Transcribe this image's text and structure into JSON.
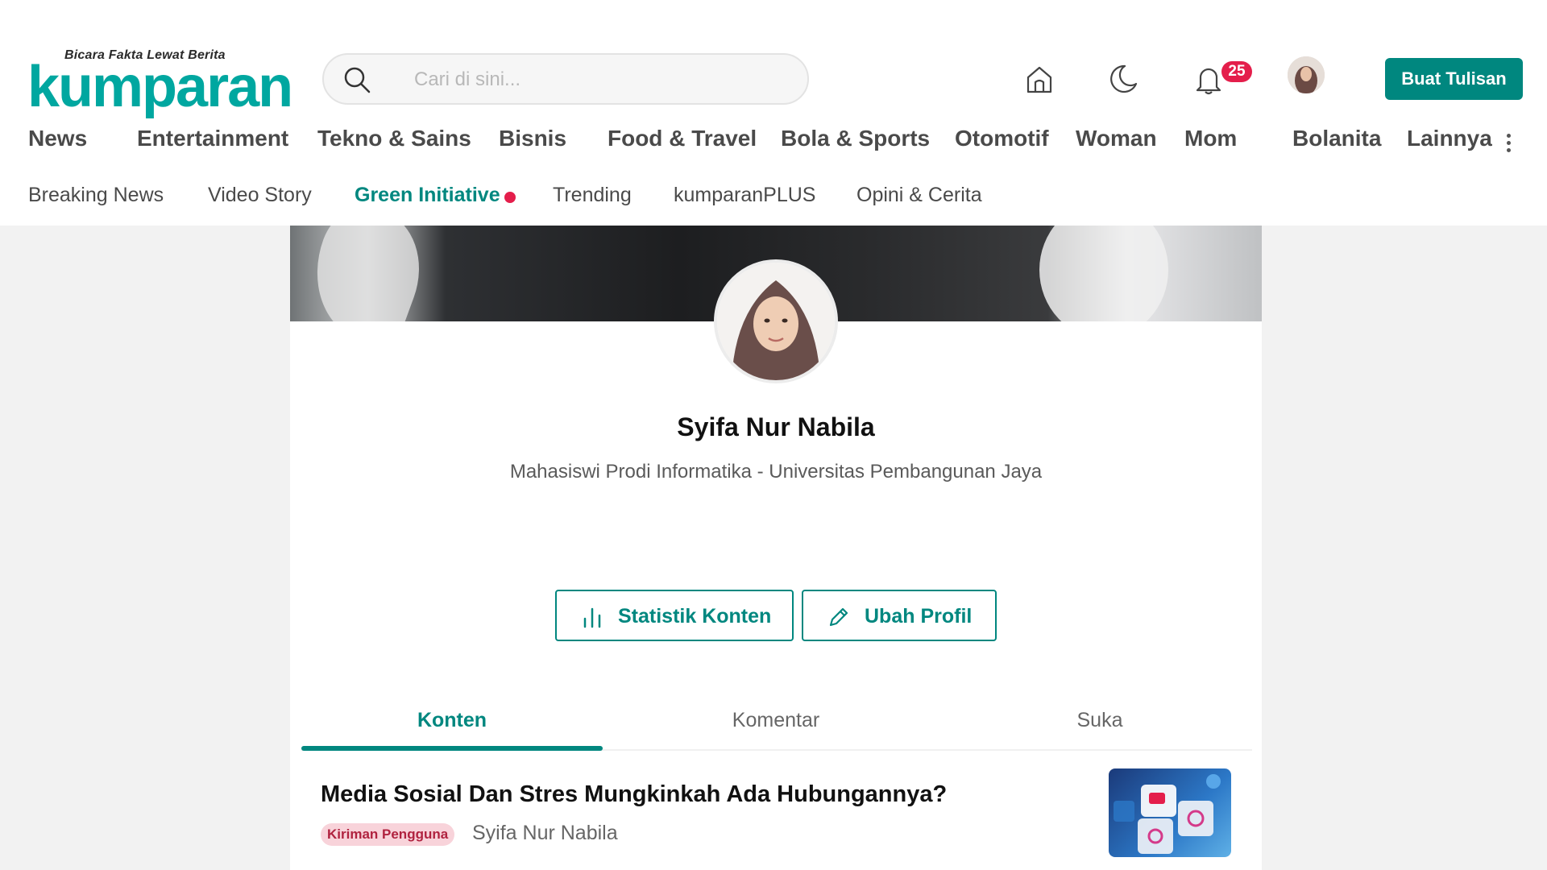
{
  "brand": {
    "tagline": "Bicara Fakta Lewat Berita",
    "name": "kumparan",
    "accent_color": "#00a7a0",
    "secondary_color": "#00877f",
    "alert_color": "#e41e4b"
  },
  "search": {
    "placeholder": "Cari di sini..."
  },
  "header_icons": [
    "home-icon",
    "moon-icon",
    "bell-icon"
  ],
  "notifications": {
    "count": "25"
  },
  "write_button": {
    "label": "Buat Tulisan"
  },
  "categories": [
    "News",
    "Entertainment",
    "Tekno & Sains",
    "Bisnis",
    "Food & Travel",
    "Bola & Sports",
    "Otomotif",
    "Woman",
    "Mom",
    "Bolanita",
    "Lainnya"
  ],
  "subnav": [
    "Breaking News",
    "Video Story",
    "Green Initiative",
    "Trending",
    "kumparanPLUS",
    "Opini & Cerita"
  ],
  "profile": {
    "name": "Syifa Nur Nabila",
    "bio": "Mahasiswi Prodi Informatika - Universitas Pembangunan Jaya"
  },
  "actions": {
    "stats_label": "Statistik Konten",
    "edit_label": "Ubah Profil"
  },
  "tabs": [
    {
      "label": "Konten",
      "active": true
    },
    {
      "label": "Komentar",
      "active": false
    },
    {
      "label": "Suka",
      "active": false
    }
  ],
  "articles": [
    {
      "title": "Media Sosial Dan Stres Mungkinkah Ada Hubungannya?",
      "tag": "Kiriman Pengguna",
      "author": "Syifa Nur Nabila"
    }
  ]
}
